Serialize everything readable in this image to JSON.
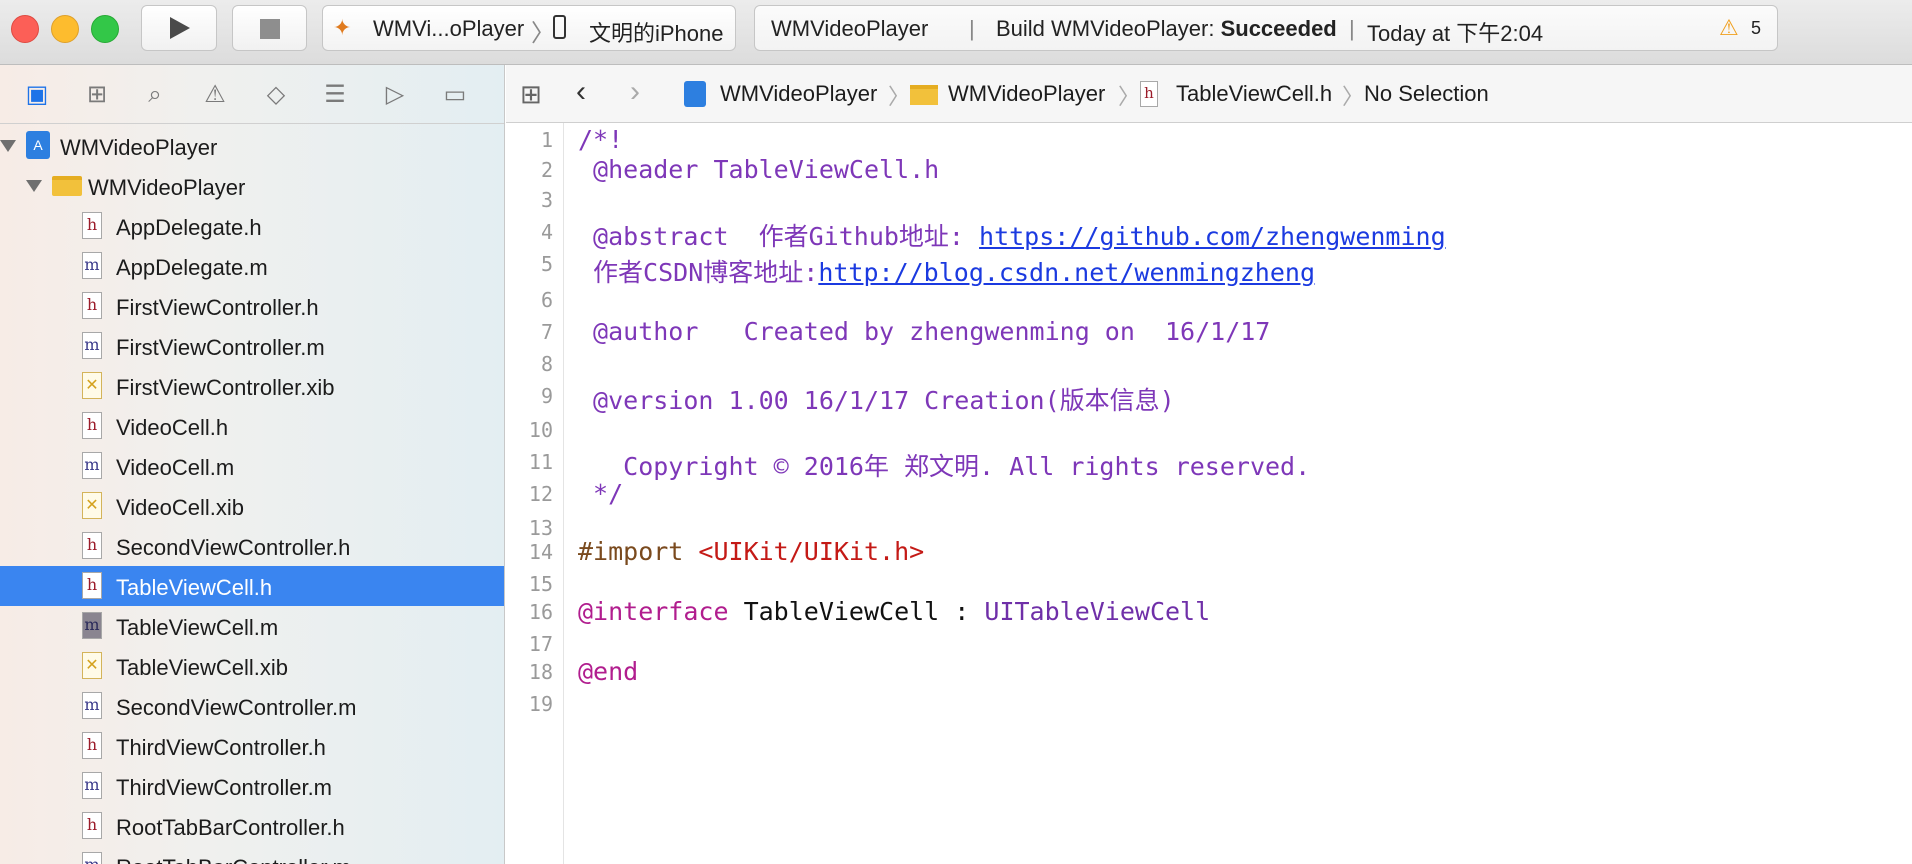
{
  "toolbar": {
    "scheme_name": "WMVi...oPlayer",
    "device_name": "文明的iPhone",
    "activity_project": "WMVideoPlayer",
    "activity_build_prefix": "Build WMVideoPlayer: ",
    "activity_build_status": "Succeeded",
    "activity_time": "Today at 下午2:04",
    "warning_count": "5"
  },
  "navigator": {
    "tabs": [
      "folder-icon",
      "hierarchy-icon",
      "search-icon",
      "warning-icon",
      "test-icon",
      "debug-icon",
      "breakpoint-icon",
      "report-icon"
    ],
    "project": "WMVideoPlayer",
    "group": "WMVideoPlayer",
    "files": [
      {
        "name": "AppDelegate.h",
        "kind": "h"
      },
      {
        "name": "AppDelegate.m",
        "kind": "m"
      },
      {
        "name": "FirstViewController.h",
        "kind": "h"
      },
      {
        "name": "FirstViewController.m",
        "kind": "m"
      },
      {
        "name": "FirstViewController.xib",
        "kind": "x"
      },
      {
        "name": "VideoCell.h",
        "kind": "h"
      },
      {
        "name": "VideoCell.m",
        "kind": "m"
      },
      {
        "name": "VideoCell.xib",
        "kind": "x"
      },
      {
        "name": "SecondViewController.h",
        "kind": "h"
      },
      {
        "name": "TableViewCell.h",
        "kind": "h",
        "selected": true
      },
      {
        "name": "TableViewCell.m",
        "kind": "m"
      },
      {
        "name": "TableViewCell.xib",
        "kind": "x"
      },
      {
        "name": "SecondViewController.m",
        "kind": "m"
      },
      {
        "name": "ThirdViewController.h",
        "kind": "h"
      },
      {
        "name": "ThirdViewController.m",
        "kind": "m"
      },
      {
        "name": "RootTabBarController.h",
        "kind": "h"
      },
      {
        "name": "RootTabBarController.m",
        "kind": "m"
      }
    ]
  },
  "jumpbar": {
    "project": "WMVideoPlayer",
    "group": "WMVideoPlayer",
    "file": "TableViewCell.h",
    "selection": "No Selection"
  },
  "editor": {
    "line_numbers": [
      "1",
      "2",
      "3",
      "4",
      "5",
      "6",
      "7",
      "8",
      "9",
      "10",
      "11",
      "12",
      "13",
      "14",
      "15",
      "16",
      "17",
      "18",
      "19"
    ],
    "l1": "/*!",
    "l2": " @header TableViewCell.h",
    "l4a": " @abstract  作者Github地址: ",
    "l4b": "https://github.com/zhengwenming",
    "l5a": " 作者CSDN博客地址:",
    "l5b": "http://blog.csdn.net/wenmingzheng",
    "l7": " @author   Created by zhengwenming on  16/1/17",
    "l9": " @version 1.00 16/1/17 Creation(版本信息)",
    "l11": "   Copyright © 2016年 郑文明. All rights reserved.",
    "l12": " */",
    "l14a": "#import ",
    "l14b": "<UIKit/UIKit.h>",
    "l16a": "@interface",
    "l16b": " TableViewCell : ",
    "l16c": "UITableViewCell",
    "l18": "@end"
  }
}
